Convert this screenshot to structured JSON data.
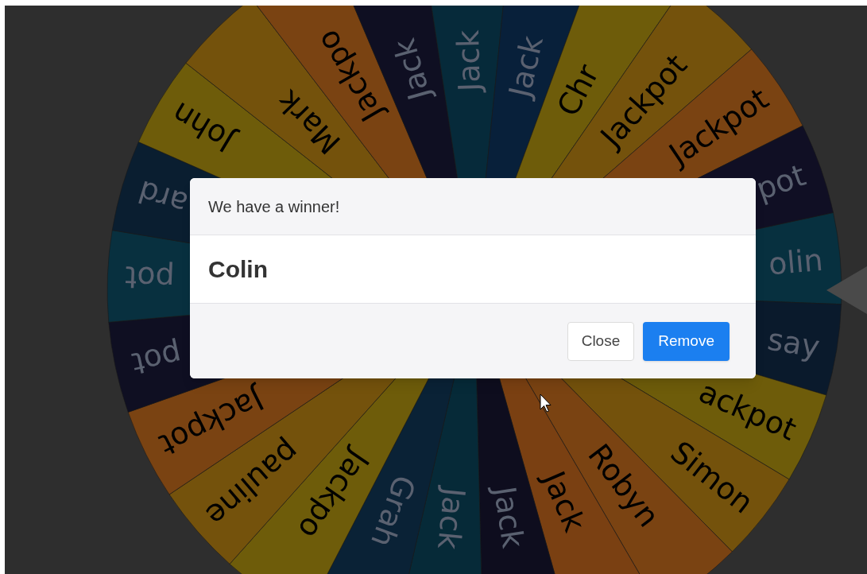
{
  "wheel": {
    "segments": [
      {
        "label": "olin",
        "color": "#07303f"
      },
      {
        "label": "say",
        "color": "#0a1a2c"
      },
      {
        "label": "ackpot",
        "color": "#6e5c0a"
      },
      {
        "label": "Simon",
        "color": "#74520c"
      },
      {
        "label": "Robyn",
        "color": "#7a4312"
      },
      {
        "label": "Jack",
        "color": "#7a4012"
      },
      {
        "label": "Jack",
        "color": "#0e0d1e"
      },
      {
        "label": "Jack",
        "color": "#062a38"
      },
      {
        "label": "Grah",
        "color": "#0a2236"
      },
      {
        "label": "Jackpo",
        "color": "#6e5c0a"
      },
      {
        "label": "pauline",
        "color": "#74520c"
      },
      {
        "label": "Jackpot",
        "color": "#7a4312"
      },
      {
        "label": "pot",
        "color": "#0f0f22"
      },
      {
        "label": "pot",
        "color": "#08303f"
      },
      {
        "label": "ard",
        "color": "#0a1e30"
      },
      {
        "label": "John",
        "color": "#6e5c0a"
      },
      {
        "label": "Mark",
        "color": "#74520c"
      },
      {
        "label": "Jackpo",
        "color": "#7a4312"
      },
      {
        "label": "Jack",
        "color": "#0f0f22"
      },
      {
        "label": "Jack",
        "color": "#062a3a"
      },
      {
        "label": "Jack",
        "color": "#08203a"
      },
      {
        "label": "Chr",
        "color": "#6e5c0a"
      },
      {
        "label": "Jackpot",
        "color": "#74520c"
      },
      {
        "label": "Jackpot",
        "color": "#7a4312"
      },
      {
        "label": "pot",
        "color": "#100f24"
      }
    ]
  },
  "dialog": {
    "title": "We have a winner!",
    "winner": "Colin",
    "buttons": [
      {
        "label": "Close",
        "kind": "secondary"
      },
      {
        "label": "Remove",
        "kind": "primary"
      }
    ]
  }
}
